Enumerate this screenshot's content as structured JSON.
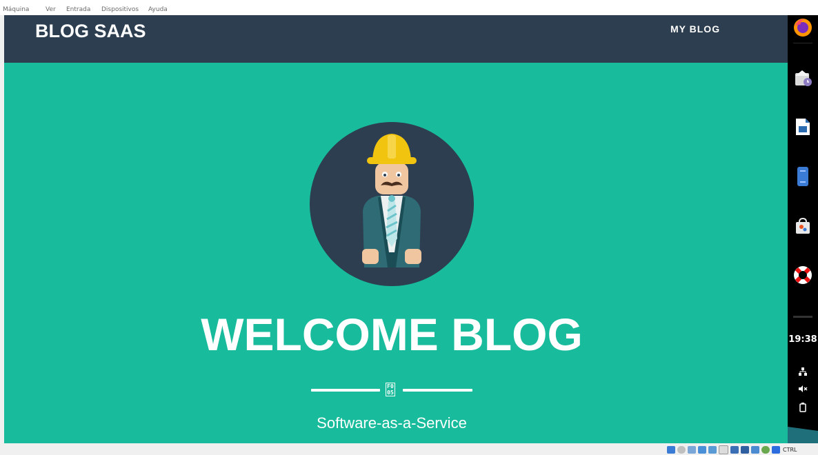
{
  "vm_menubar": {
    "items": [
      "Máquina",
      "Ver",
      "Entrada",
      "Dispositivos",
      "Ayuda"
    ]
  },
  "navbar": {
    "brand": "BLOG SAAS",
    "link": "MY BLOG"
  },
  "hero": {
    "title": "WELCOME BLOG",
    "divider_glyph": [
      "F0",
      "05"
    ],
    "subtitle": "Software-as-a-Service"
  },
  "dock": {
    "icons": [
      "firefox-icon",
      "mail-clock-icon",
      "writer-document-icon",
      "phone-app-icon",
      "software-store-icon",
      "help-lifebuoy-icon"
    ],
    "clock": "19:38"
  },
  "statusbar": {
    "host_key": "CTRL"
  },
  "colors": {
    "navbar": "#2c3e50",
    "hero": "#18bc9c",
    "avatar_bg": "#2c3e50",
    "helmet": "#f1c40f",
    "dock": "#000000"
  }
}
